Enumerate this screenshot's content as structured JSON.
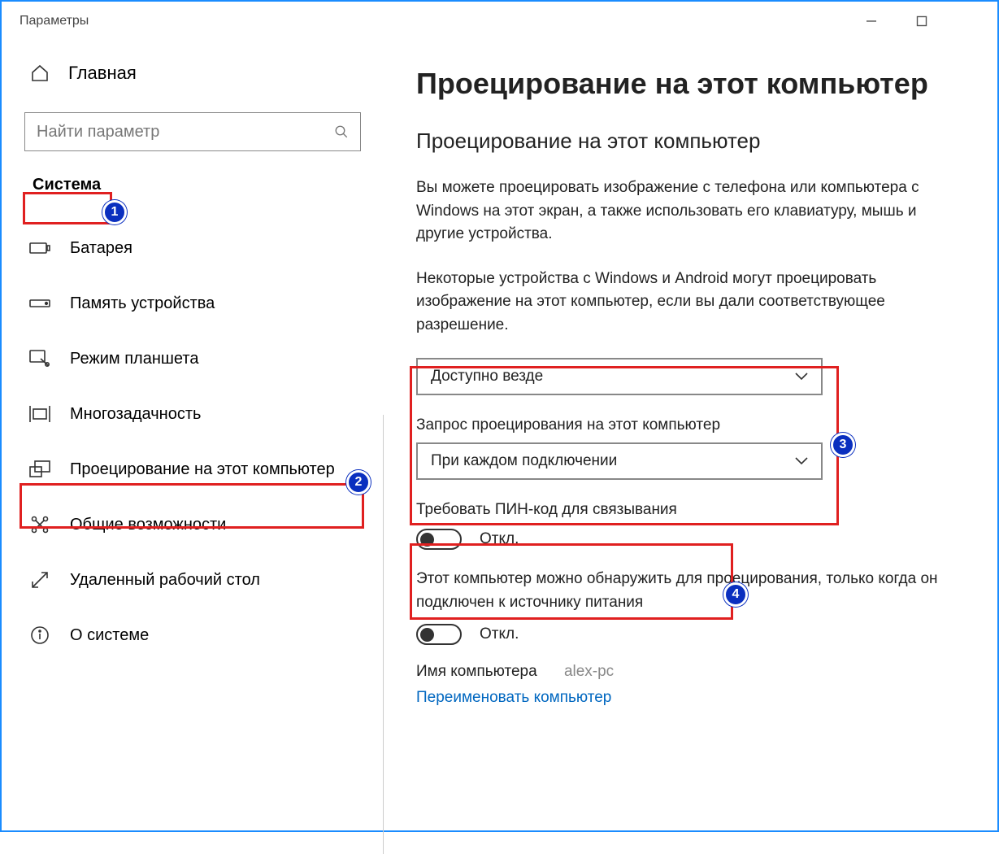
{
  "window": {
    "title": "Параметры"
  },
  "sidebar": {
    "home": "Главная",
    "search_placeholder": "Найти параметр",
    "crumb": "Система",
    "items": [
      {
        "label": "Батарея"
      },
      {
        "label": "Память устройства"
      },
      {
        "label": "Режим планшета"
      },
      {
        "label": "Многозадачность"
      },
      {
        "label": "Проецирование на этот компьютер"
      },
      {
        "label": "Общие возможности"
      },
      {
        "label": "Удаленный рабочий стол"
      },
      {
        "label": "О системе"
      }
    ]
  },
  "main": {
    "h1": "Проецирование на этот компьютер",
    "h2": "Проецирование на этот компьютер",
    "p1": "Вы можете проецировать изображение с телефона или компьютера с Windows на этот экран, а также использовать его клавиатуру, мышь и другие устройства.",
    "p2": "Некоторые устройства с Windows и Android могут проецировать изображение на этот компьютер, если вы дали соответствующее разрешение.",
    "dropdown1_value": "Доступно везде",
    "label2": "Запрос проецирования на этот компьютер",
    "dropdown2_value": "При каждом подключении",
    "pin_label": "Требовать ПИН-код для связывания",
    "pin_state": "Откл.",
    "power_label": "Этот компьютер можно обнаружить для проецирования, только когда он подключен к источнику питания",
    "power_state": "Откл.",
    "pcname_label": "Имя компьютера",
    "pcname_value": "alex-pc",
    "rename_link": "Переименовать компьютер"
  },
  "annotations": {
    "1": "1",
    "2": "2",
    "3": "3",
    "4": "4"
  }
}
